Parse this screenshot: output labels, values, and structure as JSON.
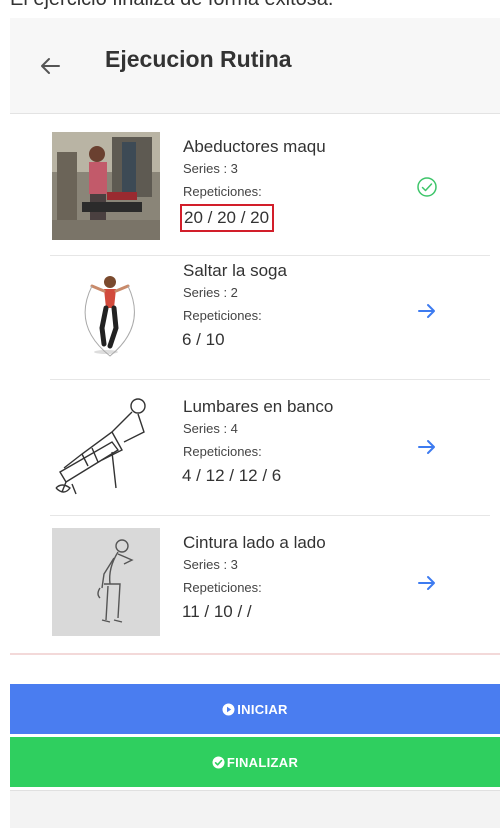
{
  "caption": "El ejercicio finaliza de forma exitosa.",
  "header": {
    "title": "Ejecucion Rutina",
    "back_icon": "arrow-left-icon"
  },
  "exercises": [
    {
      "name": "Abeductores maqu",
      "series": "Series : 3",
      "rep_label": "Repeticiones:",
      "reps": "20 / 20 / 20",
      "status_icon": "check-circle-icon",
      "status_color": "#3ec56a"
    },
    {
      "name": "Saltar la soga",
      "series": "Series : 2",
      "rep_label": "Repeticiones:",
      "reps": "6 / 10",
      "status_icon": "arrow-right-icon",
      "status_color": "#3d7bf0"
    },
    {
      "name": "Lumbares en banco",
      "series": "Series : 4",
      "rep_label": "Repeticiones:",
      "reps": "4 / 12 / 12 / 6",
      "status_icon": "arrow-right-icon",
      "status_color": "#3d7bf0"
    },
    {
      "name": "Cintura lado a lado",
      "series": "Series : 3",
      "rep_label": "Repeticiones:",
      "reps": "11 / 10 / /",
      "status_icon": "arrow-right-icon",
      "status_color": "#3d7bf0"
    }
  ],
  "buttons": {
    "start_label": "INICIAR",
    "finish_label": "FINALIZAR",
    "start_color": "#4a7df0",
    "finish_color": "#2fcf5f"
  }
}
